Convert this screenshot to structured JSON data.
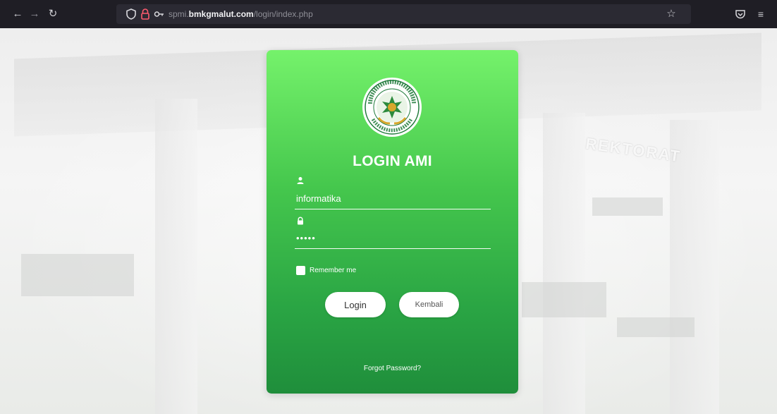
{
  "browser": {
    "url_prefix": "spmi.",
    "url_host": "bmkgmalut.com",
    "url_path": "/login/index.php",
    "icons": {
      "back": "back-arrow-icon",
      "forward": "forward-arrow-icon",
      "reload": "reload-icon",
      "shield": "tracking-shield-icon",
      "lock_warning": "insecure-lock-icon",
      "permissions": "key-icon",
      "bookmark": "star-icon",
      "pocket": "pocket-icon",
      "menu": "hamburger-menu-icon"
    }
  },
  "background": {
    "building_sign": "REKTORAT"
  },
  "login": {
    "title": "LOGIN AMI",
    "username_value": "informatika",
    "password_value": "•••••",
    "remember_label": "Remember me",
    "login_button": "Login",
    "back_button": "Kembali",
    "forgot_link": "Forgot Password?",
    "logo": "universitas-muhammadiyah-maluku-utara-seal",
    "colors": {
      "card_top": "#75f26b",
      "card_bottom": "#1f8e3b",
      "text": "#ffffff"
    }
  }
}
